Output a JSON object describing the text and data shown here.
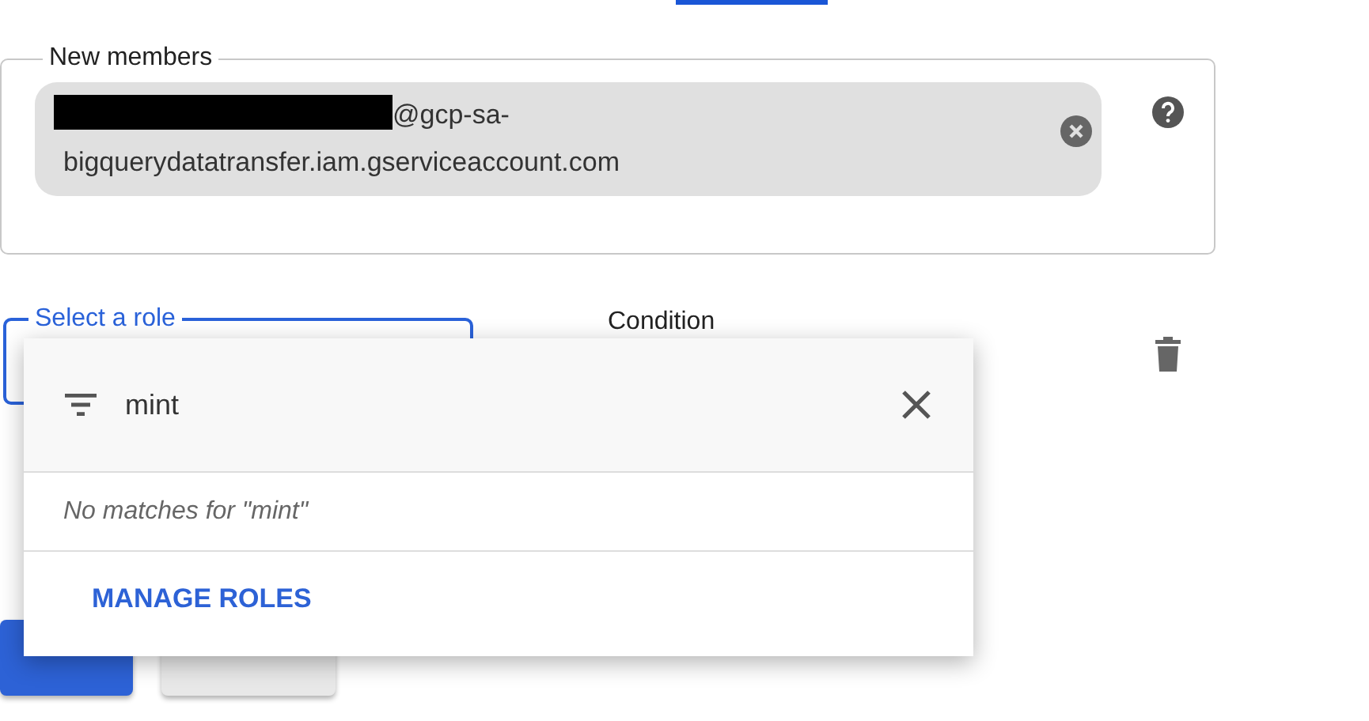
{
  "members_field": {
    "label": "New members",
    "chips": [
      {
        "redacted": true,
        "text": "@gcp-sa-bigquerydatatransfer.iam.gserviceaccount.com"
      }
    ]
  },
  "role_field": {
    "label": "Select a role",
    "focused": true
  },
  "condition": {
    "label": "Condition"
  },
  "role_menu": {
    "filter_value": "mint",
    "empty_message": "No matches for \"mint\"",
    "action": "MANAGE ROLES"
  }
}
